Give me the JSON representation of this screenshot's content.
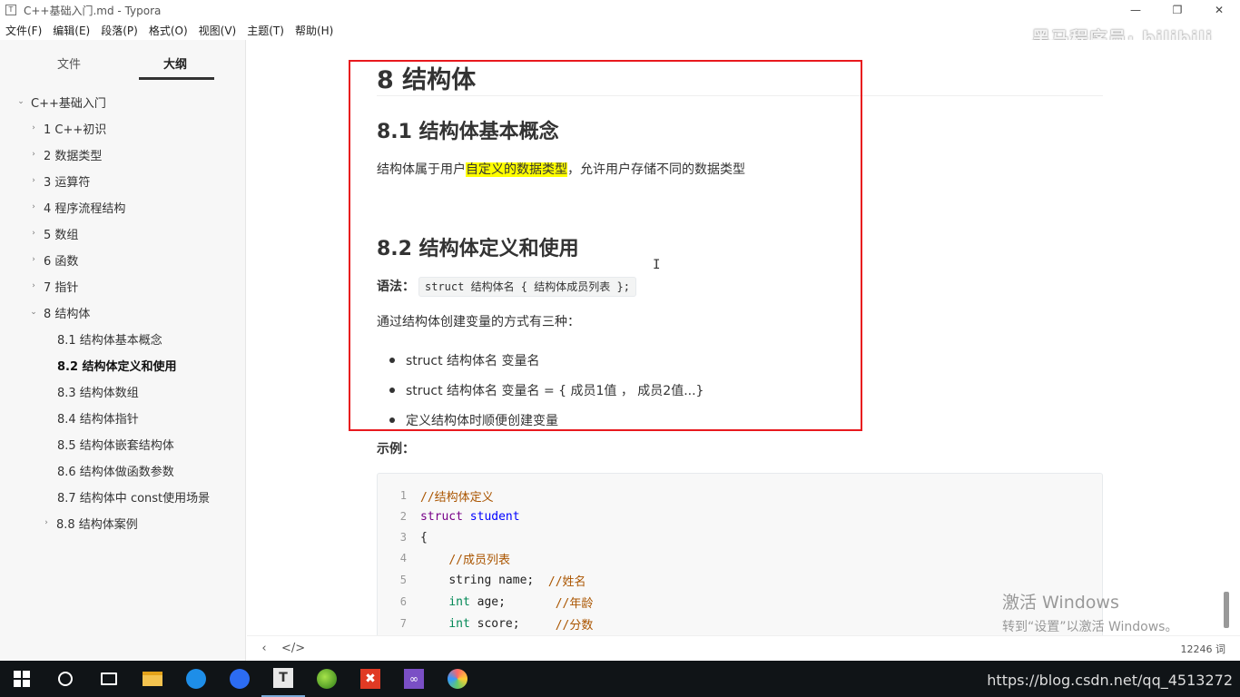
{
  "window": {
    "title": "C++基础入门.md - Typora",
    "app_icon": "T"
  },
  "watermark": "黑马程序员· bilibili",
  "menu": [
    "文件(F)",
    "编辑(E)",
    "段落(P)",
    "格式(O)",
    "视图(V)",
    "主题(T)",
    "帮助(H)"
  ],
  "sidebar": {
    "tabs": {
      "files": "文件",
      "outline": "大纲"
    },
    "outline": [
      {
        "label": "C++基础入门",
        "caret": "⌄"
      },
      {
        "label": "1 C++初识",
        "caret": "›"
      },
      {
        "label": "2 数据类型",
        "caret": "›"
      },
      {
        "label": "3 运算符",
        "caret": "›"
      },
      {
        "label": "4 程序流程结构",
        "caret": "›"
      },
      {
        "label": "5 数组",
        "caret": "›"
      },
      {
        "label": "6 函数",
        "caret": "›"
      },
      {
        "label": "7 指针",
        "caret": "›"
      },
      {
        "label": "8 结构体",
        "caret": "⌄"
      },
      {
        "label": "8.1 结构体基本概念",
        "caret": ""
      },
      {
        "label": "8.2 结构体定义和使用",
        "caret": ""
      },
      {
        "label": "8.3 结构体数组",
        "caret": ""
      },
      {
        "label": "8.4 结构体指针",
        "caret": ""
      },
      {
        "label": "8.5 结构体嵌套结构体",
        "caret": ""
      },
      {
        "label": "8.6 结构体做函数参数",
        "caret": ""
      },
      {
        "label": "8.7 结构体中 const使用场景",
        "caret": ""
      },
      {
        "label": "8.8 结构体案例",
        "caret": "›"
      }
    ]
  },
  "doc": {
    "h1": "8 结构体",
    "h2_1": "8.1 结构体基本概念",
    "p1_a": "结构体属于用户",
    "p1_hl": "自定义的数据类型",
    "p1_b": "，允许用户存储不同的数据类型",
    "h2_2": "8.2 结构体定义和使用",
    "syntax_label": "语法：",
    "syntax_code": "struct 结构体名 { 结构体成员列表 };",
    "p2": "通过结构体创建变量的方式有三种：",
    "bullets": [
      "struct 结构体名 变量名",
      "struct 结构体名 变量名 = { 成员1值 ， 成员2值...}",
      "定义结构体时顺便创建变量"
    ],
    "example_label": "示例：",
    "code": {
      "ln": [
        "1",
        "2",
        "3",
        "4",
        "5",
        "6",
        "7"
      ],
      "l1": "//结构体定义",
      "l2_kw": "struct",
      "l2_name": "student",
      "l3": "{",
      "l4": "//成员列表",
      "l5_code": "string name;",
      "l5_com": "//姓名",
      "l6_type": "int",
      "l6_code": " age;",
      "l6_com": "//年龄",
      "l7_type": "int",
      "l7_code": " score;",
      "l7_com": "//分数"
    }
  },
  "activation": {
    "line1": "激活 Windows",
    "line2": "转到“设置”以激活 Windows。"
  },
  "status": {
    "word_count": "12246 词"
  },
  "tray": "https://blog.csdn.net/qq_4513272"
}
